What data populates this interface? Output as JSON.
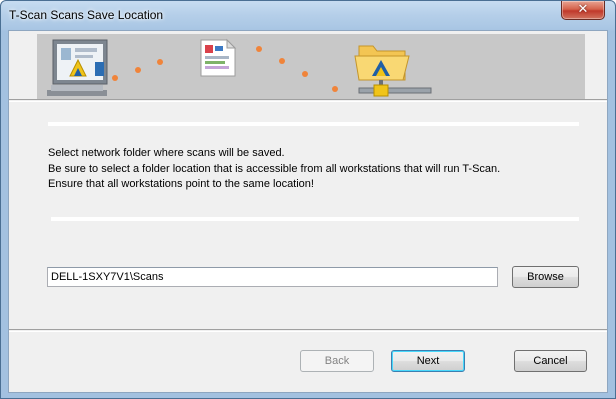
{
  "window": {
    "title": "T-Scan Scans Save Location"
  },
  "titlebar": {
    "close_glyph": "✕"
  },
  "banner": {
    "icons": [
      "scanner-computer-icon",
      "scanned-document-icon",
      "network-folder-icon"
    ],
    "dot_color": "#f0843a"
  },
  "instructions": {
    "line1": "Select network folder where scans will be saved.",
    "line2": "Be sure to select a folder location that is accessible from all workstations that will run T-Scan.",
    "line3": "Ensure that all workstations point to the same location!"
  },
  "location": {
    "path_value": "DELL-1SXY7V1\\Scans",
    "browse_label": "Browse"
  },
  "footer": {
    "back_label": "Back",
    "next_label": "Next",
    "cancel_label": "Cancel"
  }
}
